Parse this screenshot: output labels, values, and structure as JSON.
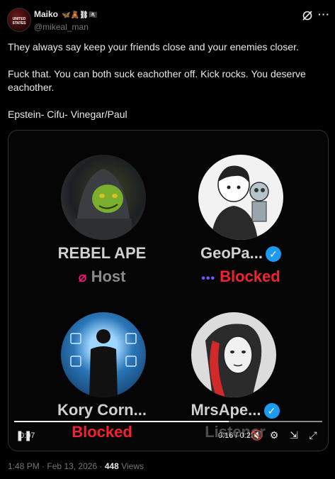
{
  "author": {
    "name": "Maiko",
    "name_emojis": "🦋🧸⛓🏴‍☠️",
    "handle": "@mikeal_man",
    "avatar_text": "UNITED STATES"
  },
  "tweet": {
    "paragraphs": [
      "They always say keep your friends close and your enemies closer.",
      "Fuck that. You can both suck eachother off. Kick rocks. You deserve eachother.",
      "Epstein- Cifu- Vinegar/Paul"
    ]
  },
  "media": {
    "speakers": [
      {
        "name": "REBEL APE",
        "role": "Host",
        "role_type": "host",
        "verified": false
      },
      {
        "name": "GeoPa...",
        "role": "Blocked",
        "role_type": "blocked",
        "verified": true
      },
      {
        "name": "Kory Corn...",
        "role": "Blocked",
        "role_type": "blocked",
        "verified": false
      },
      {
        "name": "MrsApe...",
        "role": "Listener",
        "role_type": "listener",
        "verified": true
      }
    ],
    "video": {
      "elapsed_left": "0:07",
      "time_display": "0:16 / 0:23",
      "progress": 0.696
    }
  },
  "meta": {
    "time": "1:48 PM",
    "separator": "·",
    "date": "Feb 13, 2026",
    "views_count": "448",
    "views_label": "Views"
  },
  "colors": {
    "blocked": "#f4212e",
    "verified": "#1d9bf0",
    "muted": "#71767b"
  }
}
